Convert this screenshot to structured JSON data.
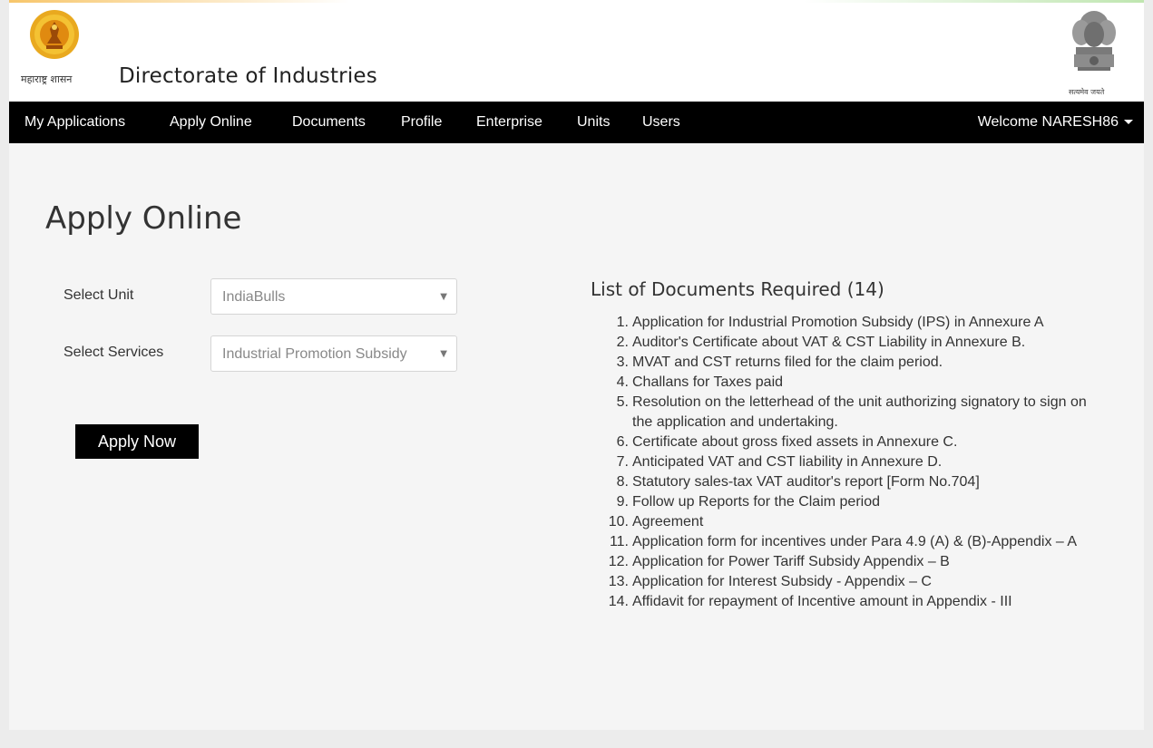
{
  "header": {
    "state_text": "महाराष्ट्र शासन",
    "title": "Directorate of Industries",
    "motto": "सत्यमेव जयते"
  },
  "nav": {
    "items": [
      {
        "label": "My Applications"
      },
      {
        "label": "Apply Online"
      },
      {
        "label": "Documents"
      },
      {
        "label": "Profile"
      },
      {
        "label": "Enterprise"
      },
      {
        "label": "Units"
      },
      {
        "label": "Users"
      }
    ],
    "welcome": "Welcome NARESH86"
  },
  "page": {
    "title": "Apply Online"
  },
  "form": {
    "unit_label": "Select Unit",
    "unit_value": "IndiaBulls",
    "services_label": "Select Services",
    "services_value": "Industrial Promotion Subsidy",
    "apply_label": "Apply Now"
  },
  "documents": {
    "title": "List of Documents Required (14)",
    "items": [
      {
        "num": "1.",
        "text": "Application for Industrial Promotion Subsidy (IPS) in Annexure A"
      },
      {
        "num": "2.",
        "text": "Auditor's Certificate about VAT & CST Liability in Annexure B."
      },
      {
        "num": "3.",
        "text": "MVAT and CST returns filed for the claim period."
      },
      {
        "num": "4.",
        "text": "Challans for Taxes paid"
      },
      {
        "num": "5.",
        "text": "Resolution on the letterhead of the unit authorizing signatory to sign on the application and undertaking."
      },
      {
        "num": "6.",
        "text": "Certificate about gross fixed assets in Annexure C."
      },
      {
        "num": "7.",
        "text": "Anticipated VAT and CST liability in Annexure D."
      },
      {
        "num": "8.",
        "text": "Statutory sales-tax VAT auditor's report [Form No.704]"
      },
      {
        "num": "9.",
        "text": "Follow up Reports for the Claim period"
      },
      {
        "num": "10.",
        "text": "Agreement"
      },
      {
        "num": "11.",
        "text": "Application form for incentives under Para 4.9 (A) & (B)-Appendix – A"
      },
      {
        "num": "12.",
        "text": "Application for Power Tariff Subsidy Appendix – B"
      },
      {
        "num": "13.",
        "text": "Application for Interest Subsidy - Appendix – C"
      },
      {
        "num": "14.",
        "text": "Affidavit for repayment of Incentive amount in Appendix - III"
      }
    ]
  },
  "colors": {
    "navbar": "#000000",
    "button": "#000000",
    "emblem_gold": "#e8a820"
  },
  "icons": {
    "left_emblem": "maharashtra-seal-icon",
    "right_emblem": "ashoka-emblem-icon",
    "dropdown": "dropdown-arrow-icon",
    "welcome_menu": "caret-down-icon"
  }
}
